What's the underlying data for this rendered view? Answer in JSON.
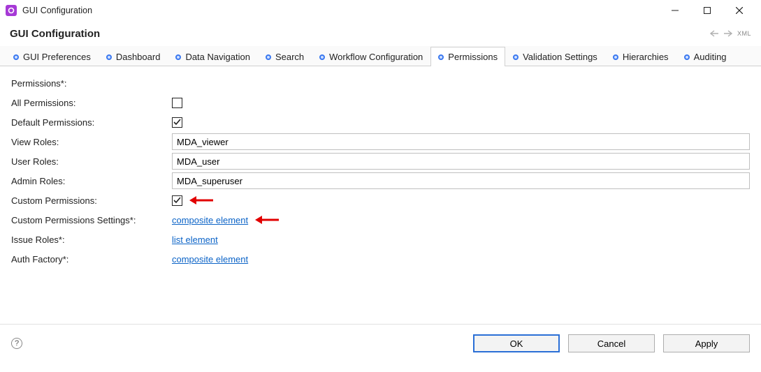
{
  "window": {
    "title": "GUI Configuration"
  },
  "header": {
    "title": "GUI Configuration",
    "xml_label": "XML"
  },
  "tabs": [
    {
      "label": "GUI Preferences",
      "active": false
    },
    {
      "label": "Dashboard",
      "active": false
    },
    {
      "label": "Data Navigation",
      "active": false
    },
    {
      "label": "Search",
      "active": false
    },
    {
      "label": "Workflow Configuration",
      "active": false
    },
    {
      "label": "Permissions",
      "active": true
    },
    {
      "label": "Validation Settings",
      "active": false
    },
    {
      "label": "Hierarchies",
      "active": false
    },
    {
      "label": "Auditing",
      "active": false
    }
  ],
  "form": {
    "permissions_label": "Permissions*:",
    "all_permissions_label": "All Permissions:",
    "all_permissions_checked": false,
    "default_permissions_label": "Default Permissions:",
    "default_permissions_checked": true,
    "view_roles_label": "View Roles:",
    "view_roles_value": "MDA_viewer",
    "user_roles_label": "User Roles:",
    "user_roles_value": "MDA_user",
    "admin_roles_label": "Admin Roles:",
    "admin_roles_value": "MDA_superuser",
    "custom_permissions_label": "Custom Permissions:",
    "custom_permissions_checked": true,
    "custom_settings_label": "Custom Permissions Settings*:",
    "custom_settings_link": "composite element",
    "issue_roles_label": "Issue Roles*:",
    "issue_roles_link": "list element",
    "auth_factory_label": "Auth Factory*:",
    "auth_factory_link": "composite element"
  },
  "buttons": {
    "ok": "OK",
    "cancel": "Cancel",
    "apply": "Apply",
    "help": "?"
  }
}
